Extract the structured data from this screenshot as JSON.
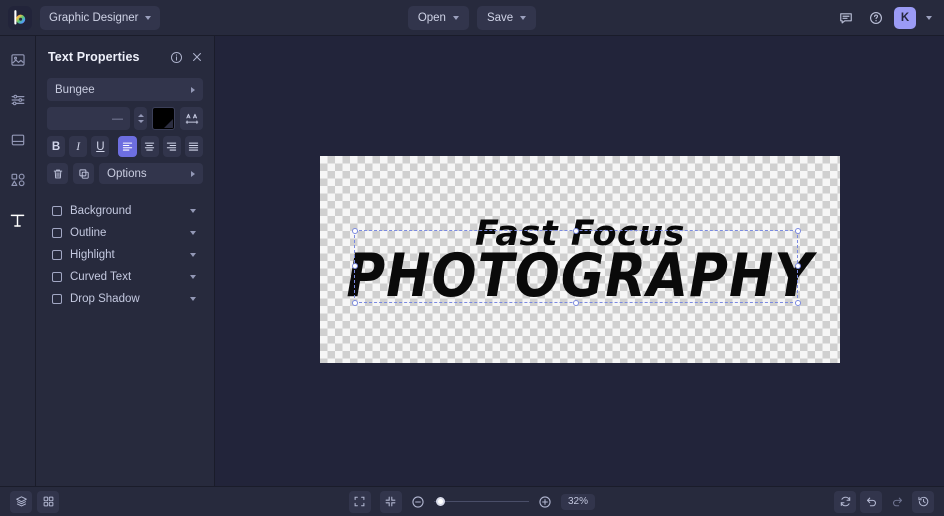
{
  "app": {
    "logo_name": "befunky-logo",
    "workspace_label": "Graphic Designer",
    "accent": "#6d6ee0",
    "avatar_bg": "#9b9bf5",
    "background": "#1e2030",
    "panel_bg": "#272a3d",
    "stage_bg": "#22243a"
  },
  "topbar": {
    "open_label": "Open",
    "save_label": "Save",
    "feedback_icon": "chat-bubble-icon",
    "help_icon": "help-circle-icon",
    "avatar_initial": "K"
  },
  "rail": {
    "items": [
      {
        "name": "image-manager",
        "icon": "image-icon",
        "active": false
      },
      {
        "name": "edit-adjust",
        "icon": "sliders-icon",
        "active": false
      },
      {
        "name": "templates",
        "icon": "frame-icon",
        "active": false
      },
      {
        "name": "graphics",
        "icon": "shapes-icon",
        "active": false
      },
      {
        "name": "text",
        "icon": "text-t-icon",
        "active": true
      }
    ]
  },
  "panel": {
    "title": "Text Properties",
    "info_icon": "info-icon",
    "close_icon": "close-icon",
    "font_family": "Bungee",
    "font_size_value": "—",
    "font_size_placeholder": "—",
    "color_swatch": "#000000",
    "letter_spacing_icon": "letter-spacing-icon",
    "format_buttons": [
      {
        "name": "bold",
        "label": "B",
        "selected": false
      },
      {
        "name": "italic",
        "label": "I",
        "selected": false
      },
      {
        "name": "underline",
        "label": "U",
        "selected": false
      },
      {
        "name": "align-left",
        "label": "align-left-icon",
        "selected": true
      },
      {
        "name": "align-center",
        "label": "align-center-icon",
        "selected": false
      },
      {
        "name": "align-right",
        "label": "align-right-icon",
        "selected": false
      },
      {
        "name": "align-justify",
        "label": "align-justify-icon",
        "selected": false
      }
    ],
    "delete_icon": "trash-icon",
    "duplicate_icon": "duplicate-icon",
    "options_label": "Options",
    "accordions": [
      {
        "label": "Background",
        "checked": false
      },
      {
        "label": "Outline",
        "checked": false
      },
      {
        "label": "Highlight",
        "checked": false
      },
      {
        "label": "Curved Text",
        "checked": false
      },
      {
        "label": "Drop Shadow",
        "checked": false
      }
    ]
  },
  "canvas": {
    "artwork_line1": "Fast Focus",
    "artwork_line2": "PHOTOGRAPHY",
    "artwork_color": "#0a0a0a",
    "selection_color": "#7b8ae0",
    "transparent_background": true
  },
  "bottombar": {
    "layers_icon": "layers-icon",
    "grid_icon": "grid-icon",
    "fit_icon": "fit-screen-icon",
    "actual_size_icon": "collapse-screen-icon",
    "zoom_out_icon": "minus-circle-icon",
    "zoom_in_icon": "plus-circle-icon",
    "zoom_level": "32%",
    "reset_icon": "reset-icon",
    "undo_icon": "undo-icon",
    "redo_icon": "redo-icon",
    "history_icon": "history-icon"
  }
}
